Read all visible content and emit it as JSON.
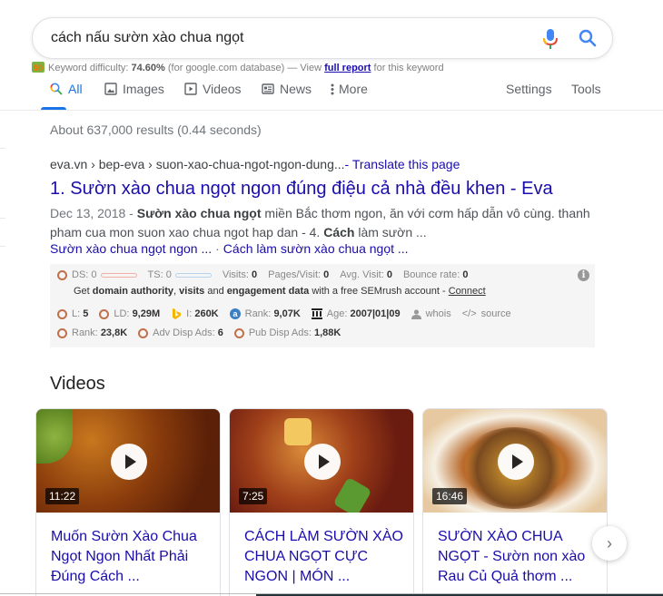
{
  "search": {
    "query": "cách nấu sườn xào chua ngọt",
    "mic_icon": "microphone-icon",
    "search_icon": "magnifier-icon"
  },
  "keyword_difficulty": {
    "label": "Keyword difficulty:",
    "value": "74.60%",
    "db_note": "(for google.com database) — View",
    "link": "full report",
    "suffix": "for this keyword"
  },
  "tabs": [
    {
      "label": "All",
      "icon": "search-icon",
      "active": true
    },
    {
      "label": "Images",
      "icon": "image-icon"
    },
    {
      "label": "Videos",
      "icon": "video-icon"
    },
    {
      "label": "News",
      "icon": "news-icon"
    },
    {
      "label": "More",
      "icon": "more-vert-icon"
    }
  ],
  "tools": {
    "settings": "Settings",
    "tools": "Tools"
  },
  "result_stats": "About 637,000 results (0.44 seconds)",
  "result": {
    "cite": "eva.vn › bep-eva › suon-xao-chua-ngot-ngon-dung...",
    "translate": "- Translate this page",
    "number": "1.",
    "title": "Sườn xào chua ngọt ngon đúng điệu cả nhà đều khen - Eva",
    "date": "Dec 13, 2018 -",
    "snippet_bold1": "Sườn xào chua ngọt",
    "snippet_part1": "miền Bắc thơm ngon, ăn với cơm hấp dẫn vô cùng. thanh pham cua mon suon xao chua ngot hap dan - 4.",
    "snippet_bold2": "Cách",
    "snippet_part2": "làm sườn ...",
    "sitelinks": [
      "Sườn xào chua ngọt ngon ...",
      "Cách làm sườn xào chua ngọt ..."
    ],
    "sitelink_sep": "·"
  },
  "semrush": {
    "ds_label": "DS:",
    "ds_value": "0",
    "ts_label": "TS:",
    "ts_value": "0",
    "visits_label": "Visits:",
    "visits_value": "0",
    "pages_label": "Pages/Visit:",
    "pages_value": "0",
    "avg_label": "Avg. Visit:",
    "avg_value": "0",
    "bounce_label": "Bounce rate:",
    "bounce_value": "0",
    "cta_pre": "Get",
    "cta_b1": "domain authority",
    "cta_mid1": ",",
    "cta_b2": "visits",
    "cta_mid2": "and",
    "cta_b3": "engagement data",
    "cta_post": "with a free SEMrush account -",
    "connect": "Connect",
    "l_label": "L:",
    "l_value": "5",
    "ld_label": "LD:",
    "ld_value": "9,29M",
    "i_label": "I:",
    "i_value": "260K",
    "alexa_label": "Rank:",
    "alexa_value": "9,07K",
    "age_label": "Age:",
    "age_value": "2007|01|09",
    "whois": "whois",
    "source": "source",
    "rank_label": "Rank:",
    "rank_value": "23,8K",
    "adv_label": "Adv Disp Ads:",
    "adv_value": "6",
    "pub_label": "Pub Disp Ads:",
    "pub_value": "1,88K",
    "info_icon": "i"
  },
  "videos": {
    "heading": "Videos",
    "items": [
      {
        "title": "Muốn Sườn Xào Chua Ngọt Ngon Nhất Phải Đúng Cách ...",
        "duration": "11:22"
      },
      {
        "title": "CÁCH LÀM SƯỜN XÀO CHUA NGỌT CỰC NGON | MÓN ...",
        "duration": "7:25"
      },
      {
        "title": "SƯỜN XÀO CHUA NGỌT - Sườn non xào Rau Củ Quả thơm ...",
        "duration": "16:46"
      }
    ],
    "next_icon": "›"
  }
}
